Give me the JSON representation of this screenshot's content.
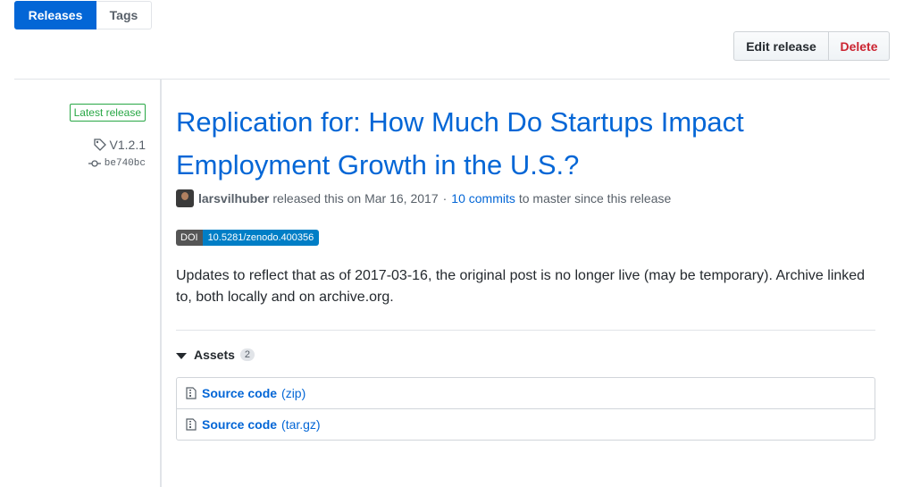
{
  "tabs": {
    "releases": "Releases",
    "tags": "Tags"
  },
  "actions": {
    "edit": "Edit release",
    "delete": "Delete"
  },
  "sidebar": {
    "latest": "Latest release",
    "tag": "V1.2.1",
    "commit": "be740bc"
  },
  "release": {
    "title": "Replication for: How Much Do Startups Impact Employment Growth in the U.S.?",
    "author": "larsvilhuber",
    "released_text": "released this on Mar 16, 2017",
    "separator": "·",
    "commits_link": "10 commits",
    "commits_suffix": "to master since this release",
    "doi_label": "DOI",
    "doi_value": "10.5281/zenodo.400356",
    "description": "Updates to reflect that as of 2017-03-16, the original post is no longer live (may be temporary). Archive linked to, both locally and on archive.org."
  },
  "assets": {
    "label": "Assets",
    "count": "2",
    "items": [
      {
        "name": "Source code",
        "ext": "(zip)"
      },
      {
        "name": "Source code",
        "ext": "(tar.gz)"
      }
    ]
  },
  "colors": {
    "accent": "#0366d6",
    "danger": "#cb2431",
    "success": "#28a745"
  }
}
